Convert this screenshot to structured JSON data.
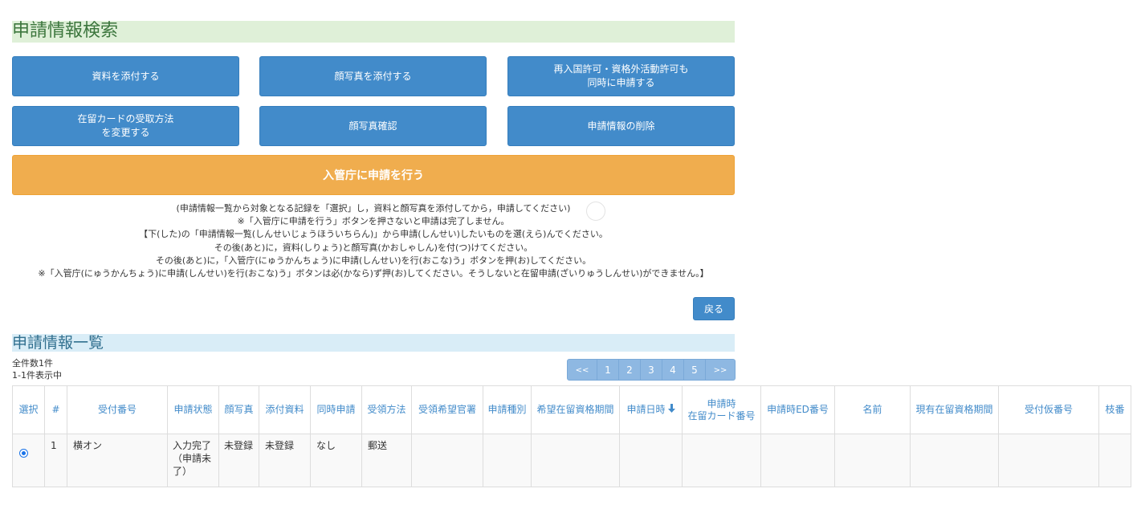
{
  "search": {
    "title": "申請情報検索",
    "buttons": {
      "attach_docs": "資料を添付する",
      "attach_photo": "顔写真を添付する",
      "reentry": "再入国許可・資格外活動許可も\n同時に申請する",
      "card_method": "在留カードの受取方法\nを変更する",
      "photo_check": "顔写真確認",
      "delete": "申請情報の削除"
    },
    "apply_button": "入管庁に申請を行う",
    "notes": [
      "(申請情報一覧から対象となる記録を「選択」し，資料と顔写真を添付してから，申請してください)",
      "※「入管庁に申請を行う」ボタンを押さないと申請は完了しません。",
      "【下(した)の「申請情報一覧(しんせいじょうほういちらん)」から申請(しんせい)したいものを選(えら)んでください。",
      "その後(あと)に，資料(しりょう)と顔写真(かおしゃしん)を付(つ)けてください。",
      "その後(あと)に，「入管庁(にゅうかんちょう)に申請(しんせい)を行(おこな)う」ボタンを押(お)してください。",
      "※「入管庁(にゅうかんちょう)に申請(しんせい)を行(おこな)う」ボタンは必(かなら)ず押(お)してください。そうしないと在留申請(ざいりゅうしんせい)ができません。】"
    ],
    "back_button": "戻る"
  },
  "list": {
    "title": "申請情報一覧",
    "total": "全件数1件",
    "showing": "1-1件表示中",
    "pager": [
      "<<",
      "1",
      "2",
      "3",
      "4",
      "5",
      ">>"
    ],
    "columns": [
      "選択",
      "#",
      "受付番号",
      "申請状態",
      "顔写真",
      "添付資料",
      "同時申請",
      "受領方法",
      "受領希望官署",
      "申請種別",
      "希望在留資格期間",
      "申請日時",
      "申請時\n在留カード番号",
      "申請時ED番号",
      "名前",
      "現有在留資格期間",
      "受付仮番号",
      "枝番"
    ],
    "sort_icon": "arrow-down-icon",
    "rows": [
      {
        "selected": true,
        "no": "1",
        "receipt": "横オン",
        "status": "入力完了（申請未了）",
        "photo": "未登録",
        "docs": "未登録",
        "simultaneous": "なし",
        "method": "郵送"
      }
    ]
  },
  "colors": {
    "primary": "#428bca",
    "warning": "#f0ad4e",
    "success_bg": "#dff0d8",
    "info_bg": "#d9edf7"
  }
}
